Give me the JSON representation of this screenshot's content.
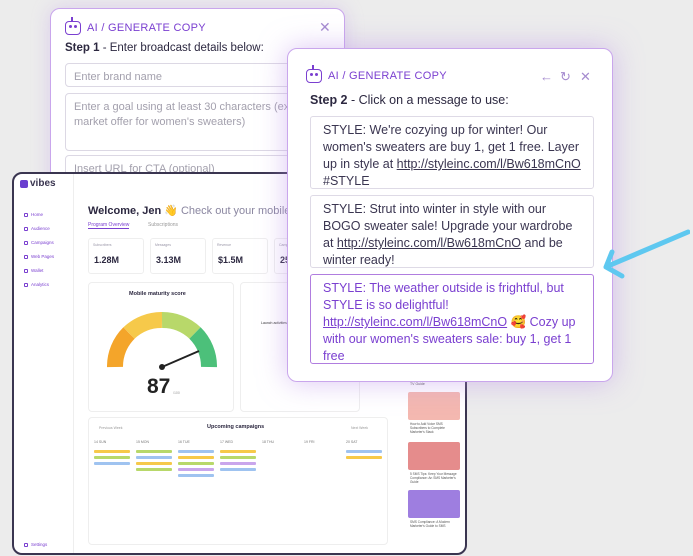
{
  "step1": {
    "header": "AI / GENERATE COPY",
    "step_prefix": "Step 1",
    "step_text": " - Enter broadcast details below:",
    "brand_placeholder": "Enter brand name",
    "goal_placeholder": "Enter a goal using at least 30 characters (ex: market offer for women's sweaters)",
    "url_placeholder": "Insert URL for CTA (optional)"
  },
  "step2": {
    "header": "AI / GENERATE COPY",
    "step_prefix": "Step 2",
    "step_text": " - Click on a message to use:",
    "messages": [
      {
        "pre": "STYLE: We're cozying up for winter! Our women's sweaters are buy 1, get 1 free. Layer up in style at ",
        "link": "http://styleinc.com/l/Bw618mCnO",
        "post": " #STYLE"
      },
      {
        "pre": "STYLE: Strut into winter in style with our BOGO sweater sale! Upgrade your wardrobe at ",
        "link": "http://styleinc.com/l/Bw618mCnO",
        "post": " and be winter ready!"
      },
      {
        "pre": "STYLE: The weather outside is frightful, but STYLE is so delightful! ",
        "link": "http://styleinc.com/l/Bw618mCnO",
        "post": " 🥰 Cozy up with our women's sweaters sale: buy 1, get 1 free"
      }
    ]
  },
  "dashboard": {
    "logo": "vibes",
    "nav": [
      "Home",
      "Audience",
      "Campaigns",
      "Web Pages",
      "Wallet",
      "Analytics"
    ],
    "settings": "Settings",
    "welcome": "Welcome, Jen 👋",
    "welcome_sub": " Check out your mobile he",
    "tabs": [
      "Program Overview",
      "Subscriptions"
    ],
    "stats": [
      "1.28M",
      "3.13M",
      "$1.5M",
      "25"
    ],
    "maturity_title": "Mobile maturity score",
    "maturity_score": "87",
    "maturity_max": "/100",
    "campaigns_title": "Upcoming campaigns",
    "prev_week": "Previous Week",
    "next_week": "Next Week",
    "days": [
      "SUN",
      "MON",
      "TUE",
      "WED",
      "THU",
      "FRI",
      "SAT"
    ],
    "dates": [
      "14",
      "15",
      "16",
      "17",
      "18",
      "19",
      "20"
    ],
    "steps_title": "Launch activities",
    "resource_label": "TV Guide",
    "resources": [
      "How to Add Voice SMS Subscribers to Complete Marketer's Stack",
      "5 SMS Tips: Keep Your Message Compliance: An SMS Marketer's Guide",
      "SMS Compliance: A Modern Marketer's Guide to SMS"
    ]
  },
  "colors": {
    "accent": "#7a3fd0",
    "arrow": "#5ec8f0"
  }
}
